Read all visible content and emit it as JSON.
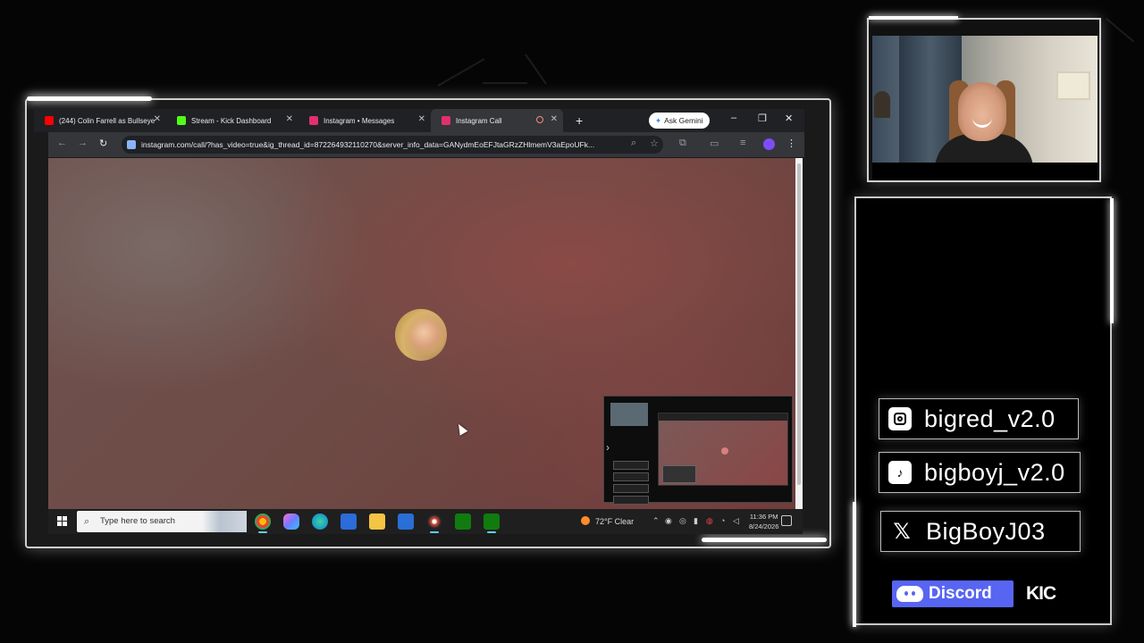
{
  "browser": {
    "tabs": [
      {
        "label": "(244) Colin Farrell as Bullseye",
        "favicon_color": "#ff0000",
        "active": false
      },
      {
        "label": "Stream - Kick Dashboard",
        "favicon_color": "#53fc18",
        "active": false
      },
      {
        "label": "Instagram • Messages",
        "favicon_color": "#e1306c",
        "active": false
      },
      {
        "label": "Instagram Call",
        "favicon_color": "#e1306c",
        "active": true
      }
    ],
    "new_tab_icon": "+",
    "gemini_label": "Ask Gemini",
    "window_controls": {
      "minimize": "–",
      "restore": "❐",
      "close": "✕"
    },
    "url": "instagram.com/call/?has_video=true&ig_thread_id=872264932110270&server_info_data=GANydmEoEFJtaGRzZHlmemV3aEpoUFk..."
  },
  "call": {
    "cursor": "arrow-cursor"
  },
  "taskbar": {
    "search_placeholder": "Type here to search",
    "weather": "72°F  Clear",
    "time": "11:36 PM",
    "date": "8/24/2026"
  },
  "overlay": {
    "instagram_handle": "bigred_v2.0",
    "tiktok_handle": "bigboyj_v2.0",
    "x_handle": "BigBoyJ03",
    "discord_label": "Discord",
    "kick_label": "KIC"
  },
  "colors": {
    "accent_discord": "#5865f2",
    "taskbar": "#1f1f1f",
    "chrome_dark": "#202124"
  }
}
